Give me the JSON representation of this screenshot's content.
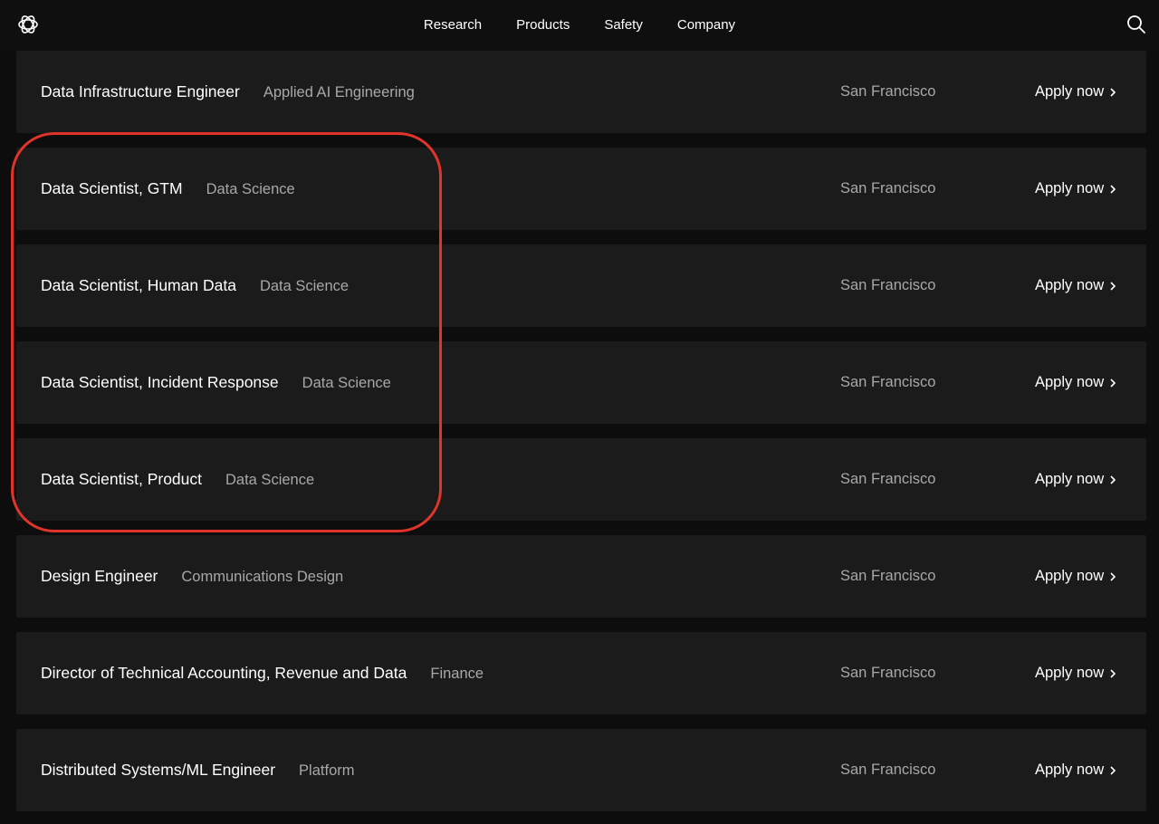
{
  "nav": {
    "links": [
      "Research",
      "Products",
      "Safety",
      "Company"
    ]
  },
  "icons": {
    "logo": "openai-logo-icon",
    "search": "search-icon",
    "chevron": "chevron-right-icon"
  },
  "jobs": [
    {
      "title": "Data Infrastructure Engineer",
      "department": "Applied AI Engineering",
      "location": "San Francisco",
      "apply": "Apply now"
    },
    {
      "title": "Data Scientist, GTM",
      "department": "Data Science",
      "location": "San Francisco",
      "apply": "Apply now"
    },
    {
      "title": "Data Scientist, Human Data",
      "department": "Data Science",
      "location": "San Francisco",
      "apply": "Apply now"
    },
    {
      "title": "Data Scientist, Incident Response",
      "department": "Data Science",
      "location": "San Francisco",
      "apply": "Apply now"
    },
    {
      "title": "Data Scientist, Product",
      "department": "Data Science",
      "location": "San Francisco",
      "apply": "Apply now"
    },
    {
      "title": "Design Engineer",
      "department": "Communications Design",
      "location": "San Francisco",
      "apply": "Apply now"
    },
    {
      "title": "Director of Technical Accounting, Revenue and Data",
      "department": "Finance",
      "location": "San Francisco",
      "apply": "Apply now"
    },
    {
      "title": "Distributed Systems/ML Engineer",
      "department": "Platform",
      "location": "San Francisco",
      "apply": "Apply now"
    }
  ],
  "colors": {
    "background": "#0d0d0d",
    "row": "#1b1b1b",
    "muted_text": "#a8a8a8",
    "highlight": "#e0342a"
  }
}
